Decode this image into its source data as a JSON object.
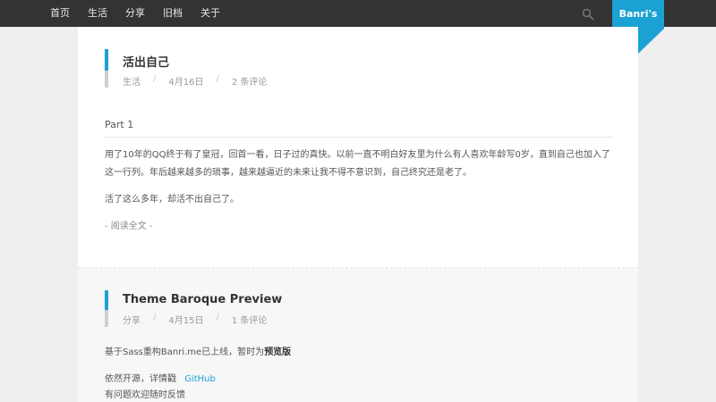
{
  "nav": {
    "items": [
      "首页",
      "生活",
      "分享",
      "旧档",
      "关于"
    ]
  },
  "brand": {
    "label": "Banri's"
  },
  "colors": {
    "accent": "#1ba1d3",
    "topbar": "#333333"
  },
  "search": {
    "icon": "search-icon"
  },
  "posts": [
    {
      "title": "活出自己",
      "category": "生活",
      "date": "4月16日",
      "comments": "2 条评论",
      "section": "Part 1",
      "para1": "用了10年的QQ终于有了皇冠，回首一看，日子过的真快。以前一直不明白好友里为什么有人喜欢年龄写0岁，直到自己也加入了",
      "para1b": "这一行列。年后越来越多的琐事，越来越逼近的未来让我不得不意识到，自己终究还是老了。",
      "para2": "活了这么多年，却活不出自己了。",
      "readmore": "- 阅读全文 -"
    },
    {
      "title": "Theme Baroque Preview",
      "category": "分享",
      "date": "4月15日",
      "comments": "1 条评论",
      "line1_prefix": "基于Sass重构Banri.me已上线，暂时为",
      "line1_bold": "预览版",
      "line2_prefix": "依然开源，详情戳",
      "line2_link": "GitHub",
      "line3": "有问题欢迎随时反馈"
    }
  ]
}
